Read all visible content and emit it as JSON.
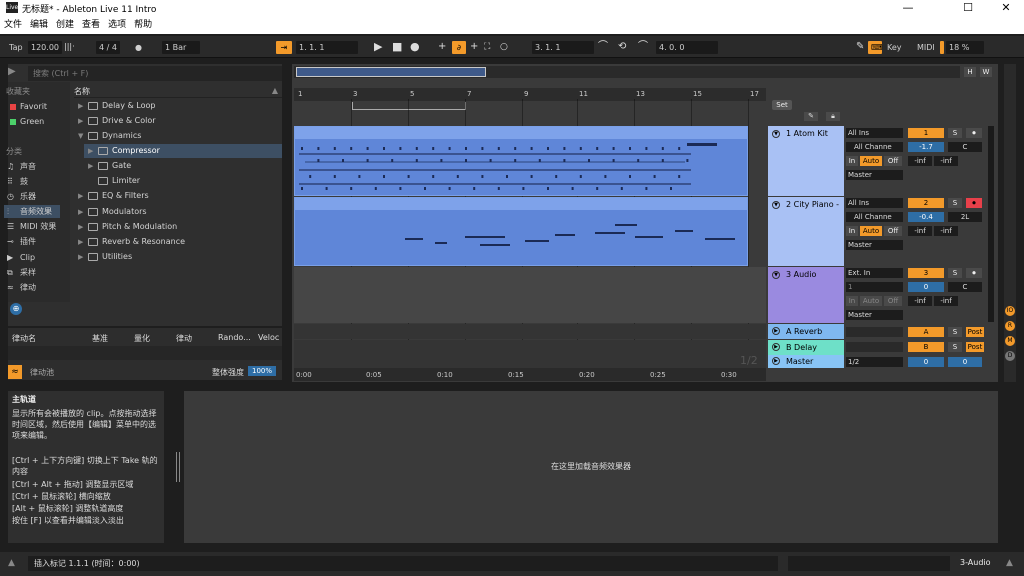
{
  "window": {
    "title": "无标题* - Ableton Live 11 Intro",
    "logo": "Live",
    "min": "—",
    "max": "☐",
    "close": "✕"
  },
  "menu": [
    "文件",
    "编辑",
    "创建",
    "查看",
    "选项",
    "帮助"
  ],
  "transport": {
    "tap": "Tap",
    "tempo": "120.00",
    "meter": "4 / 4",
    "metro": "●",
    "quant": "1 Bar",
    "arrangement_pos": "1.   1.   1",
    "loop_start": "3.   1.   1",
    "loop_len": "4.   0.   0",
    "key": "Key",
    "midi": "MIDI",
    "cpu": "18 %"
  },
  "browser": {
    "search_placeholder": "搜索 (Ctrl + F)",
    "col_header": "名称",
    "collections_title": "收藏夹",
    "collections": [
      {
        "label": "Favorit",
        "color": "#e94444"
      },
      {
        "label": "Green",
        "color": "#4cd06a"
      }
    ],
    "categories_title": "分类",
    "categories": [
      {
        "label": "声音",
        "icon": "♫"
      },
      {
        "label": "鼓",
        "icon": "⠿"
      },
      {
        "label": "乐器",
        "icon": "◷"
      },
      {
        "label": "音频效果",
        "icon": "⫶"
      },
      {
        "label": "MIDI 效果",
        "icon": "☰"
      },
      {
        "label": "插件",
        "icon": "⊸"
      },
      {
        "label": "Clip",
        "icon": "▶"
      },
      {
        "label": "采样",
        "icon": "⧉"
      },
      {
        "label": "律动",
        "icon": "≈"
      }
    ],
    "items": [
      {
        "label": "Delay & Loop",
        "arrow": "▶",
        "indent": 0,
        "selected": false
      },
      {
        "label": "Drive & Color",
        "arrow": "▶",
        "indent": 0,
        "selected": false
      },
      {
        "label": "Dynamics",
        "arrow": "▼",
        "indent": 0,
        "selected": false
      },
      {
        "label": "Compressor",
        "arrow": "▶",
        "indent": 1,
        "selected": true
      },
      {
        "label": "Gate",
        "arrow": "▶",
        "indent": 1,
        "selected": false
      },
      {
        "label": "Limiter",
        "arrow": "",
        "indent": 1,
        "selected": false
      },
      {
        "label": "EQ & Filters",
        "arrow": "▶",
        "indent": 0,
        "selected": false
      },
      {
        "label": "Modulators",
        "arrow": "▶",
        "indent": 0,
        "selected": false
      },
      {
        "label": "Pitch & Modulation",
        "arrow": "▶",
        "indent": 0,
        "selected": false
      },
      {
        "label": "Reverb & Resonance",
        "arrow": "▶",
        "indent": 0,
        "selected": false
      },
      {
        "label": "Utilities",
        "arrow": "▶",
        "indent": 0,
        "selected": false
      }
    ]
  },
  "groove": {
    "headers": [
      "律动名",
      "基准",
      "量化",
      "律动",
      "Rando...",
      "Veloc"
    ],
    "pool_label": "律动池",
    "global_label": "整体强度",
    "global_value": "100%"
  },
  "arrangement": {
    "bar_numbers": [
      "1",
      "3",
      "5",
      "7",
      "9",
      "11",
      "13",
      "15",
      "17"
    ],
    "time_labels": [
      "0:00",
      "0:05",
      "0:10",
      "0:15",
      "0:20",
      "0:25",
      "0:30"
    ],
    "set_label": "Set",
    "page_indicator": "1/2",
    "h_btn": "H",
    "w_btn": "W",
    "tracks": [
      {
        "name": "1 Atom Kit",
        "input": "All Ins",
        "channel": "All Channe",
        "mon_in": "In",
        "mon_auto": "Auto",
        "mon_off": "Off",
        "out": "Master",
        "num": "1",
        "solo": "S",
        "vol": "-1.7",
        "pan": "C",
        "peak_l": "-inf",
        "peak_r": "-inf",
        "color": "#a9c1f4"
      },
      {
        "name": "2 City Piano -",
        "input": "All Ins",
        "channel": "All Channe",
        "mon_in": "In",
        "mon_auto": "Auto",
        "mon_off": "Off",
        "out": "Master",
        "num": "2",
        "solo": "S",
        "vol": "-0.4",
        "pan": "2L",
        "peak_l": "-inf",
        "peak_r": "-inf",
        "color": "#a9c1f4"
      },
      {
        "name": "3 Audio",
        "input": "Ext. In",
        "channel": "1",
        "mon_in": "In",
        "mon_auto": "Auto",
        "mon_off": "Off",
        "out": "Master",
        "num": "3",
        "solo": "S",
        "vol": "0",
        "pan": "C",
        "peak_l": "-inf",
        "peak_r": "-inf",
        "color": "#9a8ae0"
      }
    ],
    "returns": [
      {
        "name": "A Reverb",
        "letter": "A",
        "solo": "S",
        "post": "Post",
        "color": "#7fb8f0"
      },
      {
        "name": "B Delay",
        "letter": "B",
        "solo": "S",
        "post": "Post",
        "color": "#6ee0c8"
      }
    ],
    "master": {
      "name": "Master",
      "cue": "1/2",
      "vol": "0",
      "pan": "0",
      "color": "#88c4f5"
    }
  },
  "info": {
    "title": "主轨道",
    "text1": "显示所有会被播放的 clip。点按拖动选择时间区域，然后使用【编辑】菜单中的选项来编辑。",
    "text2": "[Ctrl + 上下方向键] 切换上下 Take 轨的内容",
    "text3": "[Ctrl + Alt + 拖动] 调整显示区域",
    "text4": "[Ctrl + 鼠标滚轮] 横向缩放",
    "text5": "[Alt + 鼠标滚轮] 调整轨道高度",
    "text6": "按住 [F] 以查看并编辑淡入淡出"
  },
  "device": {
    "drop_hint": "在这里加载音频效果器"
  },
  "status": {
    "message": "插入标记 1.1.1 (时间：0:00)",
    "track": "3-Audio"
  }
}
